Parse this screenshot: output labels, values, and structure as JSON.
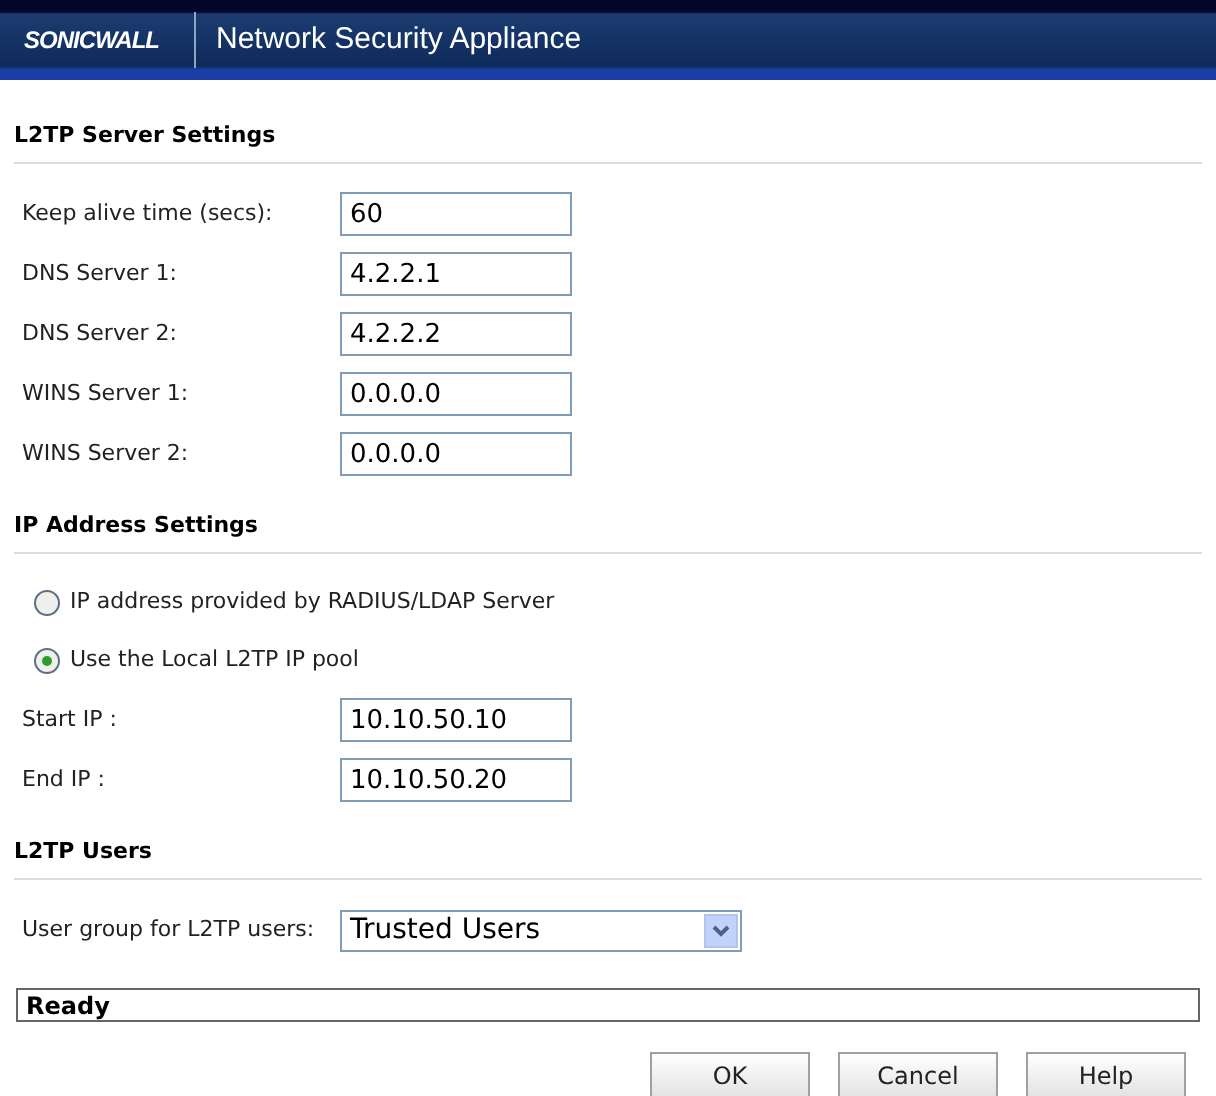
{
  "header": {
    "logo": "SONICWALL",
    "title": "Network Security Appliance"
  },
  "sections": [
    {
      "title": "L2TP Server Settings",
      "rows": [
        {
          "kind": "field",
          "label": "Keep alive time (secs):",
          "value": "60"
        },
        {
          "kind": "field",
          "label": "DNS Server 1:",
          "value": "4.2.2.1"
        },
        {
          "kind": "field",
          "label": "DNS Server 2:",
          "value": "4.2.2.2"
        },
        {
          "kind": "field",
          "label": "WINS Server 1:",
          "value": "0.0.0.0"
        },
        {
          "kind": "field",
          "label": "WINS Server 2:",
          "value": "0.0.0.0"
        }
      ]
    },
    {
      "title": "IP Address Settings",
      "rows": [
        {
          "kind": "radio",
          "label": "IP address provided by RADIUS/LDAP Server",
          "selected": false
        },
        {
          "kind": "radio",
          "label": "Use the Local L2TP IP pool",
          "selected": true
        },
        {
          "kind": "field",
          "label": "Start IP :",
          "value": "10.10.50.10"
        },
        {
          "kind": "field",
          "label": "End IP :",
          "value": "10.10.50.20"
        }
      ]
    },
    {
      "title": "L2TP Users",
      "rows": [
        {
          "kind": "select",
          "label": "User group for L2TP users:",
          "value": "Trusted Users"
        }
      ]
    }
  ],
  "status_bar": "Ready",
  "buttons": [
    "OK",
    "Cancel",
    "Help"
  ]
}
